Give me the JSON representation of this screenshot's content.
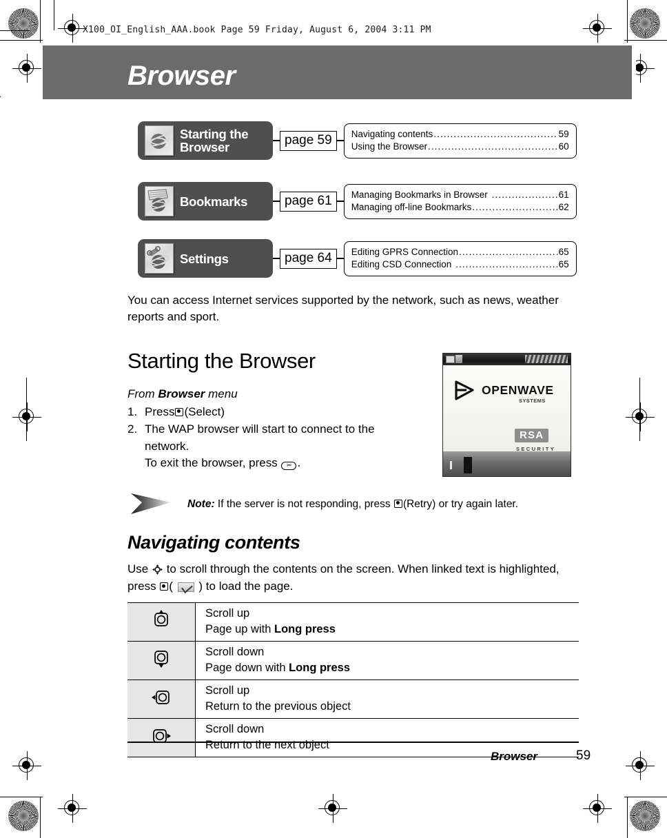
{
  "print_header": "X100_OI_English_AAA.book  Page 59  Friday, August 6, 2004  3:11 PM",
  "chapter": {
    "title": "Browser"
  },
  "overview": [
    {
      "icon": "globe-browser-icon",
      "label": "Starting the\nBrowser",
      "label_line1": "Starting the",
      "label_line2": "Browser",
      "page_chip": "page 59",
      "entries": [
        {
          "label": "Navigating contents",
          "page": "59"
        },
        {
          "label": "Using the Browser",
          "page": "60"
        }
      ]
    },
    {
      "icon": "bookmarks-globe-icon",
      "label": "Bookmarks",
      "label_line1": "Bookmarks",
      "label_line2": "",
      "page_chip": "page 61",
      "entries": [
        {
          "label": "Managing Bookmarks in Browser",
          "page": "61"
        },
        {
          "label": "Managing off-line Bookmarks",
          "page": "62"
        }
      ]
    },
    {
      "icon": "settings-wrench-globe-icon",
      "label": "Settings",
      "label_line1": "Settings",
      "label_line2": "",
      "page_chip": "page 64",
      "entries": [
        {
          "label": "Editing GPRS Connection",
          "page": "65"
        },
        {
          "label": "Editing CSD Connection",
          "page": "65"
        }
      ]
    }
  ],
  "intro": "You can access Internet services supported by the network, such as news, weather reports and sport.",
  "section1": {
    "heading": "Starting the Browser",
    "from_prefix": "From ",
    "from_bold": "Browser",
    "from_suffix": " menu",
    "steps": [
      {
        "num": "1.",
        "parts": [
          {
            "type": "text",
            "value": "Press "
          },
          {
            "type": "glyph",
            "value": "select-key-icon"
          },
          {
            "type": "text",
            "value": "(Select)"
          }
        ],
        "plain": "Press (Select)"
      },
      {
        "num": "2.",
        "parts": [
          {
            "type": "text",
            "value": "The WAP browser will start to connect to the network."
          },
          {
            "type": "break",
            "value": ""
          },
          {
            "type": "text",
            "value": "To exit the browser, press "
          },
          {
            "type": "glyph",
            "value": "end-call-key-icon"
          },
          {
            "type": "text",
            "value": "."
          }
        ],
        "line1": "The WAP browser will start to connect to the",
        "line2": "network.",
        "line3_prefix": "To exit the browser, press ",
        "line3_suffix": "."
      }
    ]
  },
  "phone_screenshot": {
    "name": "openwave-splash-screenshot",
    "brand": "OPENWAVE",
    "brand_sub": "SYSTEMS",
    "security_badge": "RSA",
    "security_sub": "SECURITY"
  },
  "note": {
    "label": "Note:",
    "text_before": " If the server is not responding, press ",
    "glyph": "select-key-icon",
    "text_after": "(Retry) or try again later."
  },
  "section2": {
    "heading": "Navigating contents",
    "para_part1": "Use ",
    "para_glyph1": "navigation-key-icon",
    "para_part2": " to scroll through the contents on the screen. When linked text is highlighted, press ",
    "para_glyph2": "select-key-icon",
    "para_part3": "( ",
    "para_glyph3": "soft-key-check-icon",
    "para_part4": " ) to load the page."
  },
  "key_table": [
    {
      "key_icon": "nav-key-up-icon",
      "line1": "Scroll up",
      "line2_prefix": "Page up with ",
      "line2_bold": "Long press"
    },
    {
      "key_icon": "nav-key-down-icon",
      "line1": "Scroll down",
      "line2_prefix": "Page down with ",
      "line2_bold": "Long press"
    },
    {
      "key_icon": "nav-key-left-icon",
      "line1": "Scroll up",
      "line2_prefix": "Return to the previous object",
      "line2_bold": ""
    },
    {
      "key_icon": "nav-key-right-icon",
      "line1": "Scroll down",
      "line2_prefix": "Return to the next object",
      "line2_bold": ""
    }
  ],
  "footer": {
    "label": "Browser",
    "page": "59"
  },
  "colors": {
    "band_gray": "#6b6b6b",
    "card_gray": "#4f4f4f",
    "table_key_bg": "#e6e6e6"
  }
}
